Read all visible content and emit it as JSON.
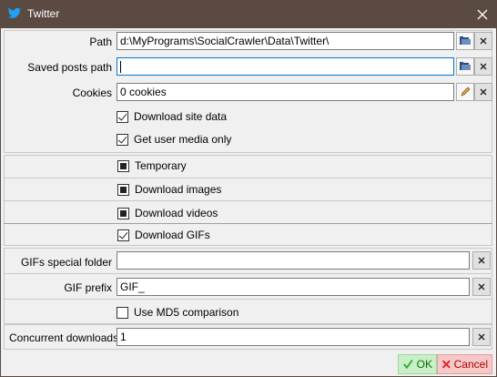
{
  "window": {
    "title": "Twitter"
  },
  "path": {
    "label": "Path",
    "value": "d:\\MyPrograms\\SocialCrawler\\Data\\Twitter\\"
  },
  "saved_posts": {
    "label": "Saved posts path",
    "value": ""
  },
  "cookies": {
    "label": "Cookies",
    "value": "0 cookies"
  },
  "download_site_data": {
    "label": "Download site data",
    "checked": true
  },
  "get_user_media_only": {
    "label": "Get user media only",
    "checked": true
  },
  "temporary": {
    "label": "Temporary",
    "state": "indeterminate"
  },
  "download_images": {
    "label": "Download images",
    "state": "indeterminate"
  },
  "download_videos": {
    "label": "Download videos",
    "state": "indeterminate"
  },
  "download_gifs": {
    "label": "Download GIFs",
    "checked": true
  },
  "gifs_folder": {
    "label": "GIFs special folder",
    "value": ""
  },
  "gif_prefix": {
    "label": "GIF prefix",
    "value": "GIF_"
  },
  "md5": {
    "label": "Use MD5 comparison",
    "checked": false
  },
  "concurrent": {
    "label": "Concurrent downloads",
    "value": "1"
  },
  "buttons": {
    "ok": "OK",
    "cancel": "Cancel"
  },
  "colors": {
    "titlebar": "#5a4a42",
    "focus_border": "#0078d7",
    "ok": "#0b6e0b",
    "cancel": "#b00000"
  }
}
